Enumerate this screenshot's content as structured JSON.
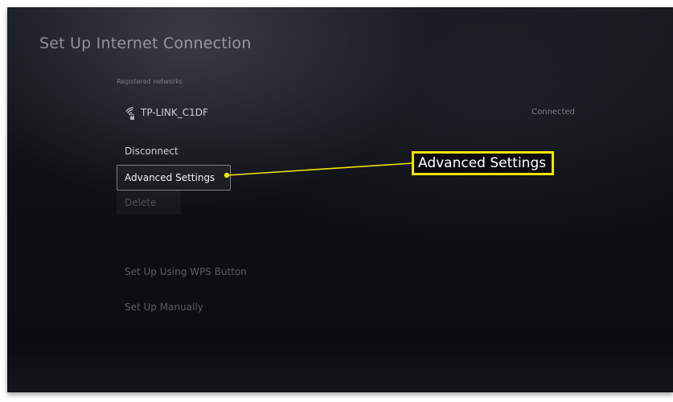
{
  "page": {
    "title": "Set Up Internet Connection"
  },
  "registered_networks": {
    "label": "Registered networks",
    "items": [
      {
        "name": "TP-LINK_C1DF",
        "status": "Connected",
        "icon": "wifi-locked-icon"
      }
    ]
  },
  "context_menu": {
    "disconnect": "Disconnect",
    "advanced_settings": "Advanced Settings",
    "delete": "Delete"
  },
  "setup_options": {
    "wps": "Set Up Using WPS Button",
    "manual": "Set Up Manually"
  },
  "annotation": {
    "callout_text": "Advanced Settings",
    "highlight_color": "#f2e600"
  }
}
